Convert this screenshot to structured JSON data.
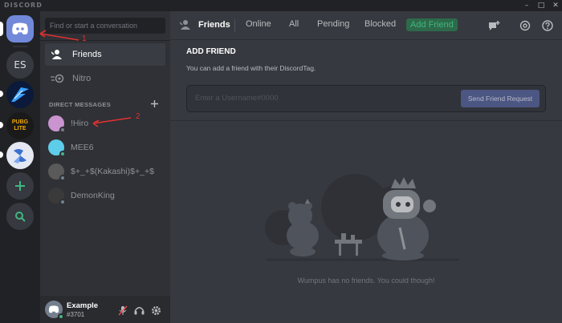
{
  "window": {
    "brand": "DISCORD",
    "controls": [
      "–",
      "□",
      "✕"
    ]
  },
  "servers": [
    {
      "name": "home",
      "icon": "discord-logo-icon"
    },
    {
      "label": "ES"
    },
    {
      "name": "server-1",
      "icon": "wing-logo-icon"
    },
    {
      "name": "server-2",
      "label": "PUBG LITE"
    },
    {
      "name": "server-3",
      "icon": "pinwheel-icon"
    },
    {
      "name": "add-server",
      "icon": "plus-icon"
    },
    {
      "name": "explore",
      "icon": "magnifier-icon"
    }
  ],
  "sidebar": {
    "search_placeholder": "Find or start a conversation",
    "nav": [
      {
        "label": "Friends",
        "icon": "friends-icon",
        "active": true
      },
      {
        "label": "Nitro",
        "icon": "nitro-icon",
        "active": false
      }
    ],
    "dm_header": "DIRECT MESSAGES",
    "dm_add_icon": "plus-icon",
    "dms": [
      {
        "name": "!Hiro",
        "status": "offline"
      },
      {
        "name": "MEE6",
        "status": "online"
      },
      {
        "name": "$+_+$(Kakashi)$+_+$",
        "status": "offline"
      },
      {
        "name": "DemonKing",
        "status": "offline"
      }
    ],
    "user": {
      "name": "Example",
      "tag": "#3701",
      "controls": [
        "mute-mic-icon",
        "headphones-icon",
        "settings-gear-icon"
      ]
    }
  },
  "topbar": {
    "title": "Friends",
    "tabs": [
      "Online",
      "All",
      "Pending",
      "Blocked"
    ],
    "add_friend": "Add Friend",
    "icons": [
      "new-group-dm-icon",
      "mention-icon",
      "help-icon"
    ]
  },
  "add_friend": {
    "title": "ADD FRIEND",
    "description": "You can add a friend with their DiscordTag.",
    "input_placeholder": "Enter a Username#0000",
    "button": "Send Friend Request"
  },
  "empty_state": {
    "message": "Wumpus has no friends. You could though!"
  },
  "annotations": {
    "label_1": "1",
    "label_2": "2",
    "color": "#e03030"
  }
}
